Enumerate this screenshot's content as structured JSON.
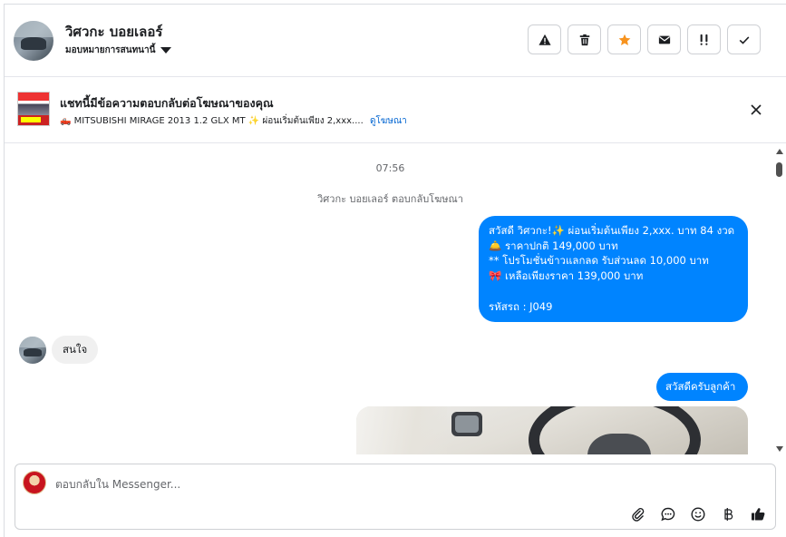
{
  "header": {
    "name": "วิศวกะ บอยเลอร์",
    "assign_label": "มอบหมายการสนทนานี้",
    "actions": [
      {
        "icon": "warning-icon"
      },
      {
        "icon": "trash-icon"
      },
      {
        "icon": "star-icon",
        "color": "#f7931e"
      },
      {
        "icon": "mail-icon"
      },
      {
        "icon": "priority-icon"
      },
      {
        "icon": "check-icon"
      }
    ]
  },
  "ad": {
    "title": "แชทนี้มีข้อความตอบกลับต่อโฆษณาของคุณ",
    "line": "🛻 MITSUBISHI MIRAGE 2013 1.2 GLX MT ✨ ผ่อนเริ่มต้นเพียง 2,xxx....",
    "link": "ดูโฆษณา"
  },
  "chat": {
    "time": "07:56",
    "system_text": "วิศวกะ บอยเลอร์ ตอบกลับโฆษณา",
    "outgoing_1": [
      "สวัสดี วิศวกะ!✨  ผ่อนเริ่มต้นเพียง 2,xxx. บาท 84 งวด",
      "🛎️ ราคาปกติ 149,000 บาท",
      "** โปรโมชั่นข้าวแลกลด รับส่วนลด 10,000 บาท",
      "🎀  เหลือเพียงราคา 139,000 บาท",
      "",
      " รหัสรถ : J049"
    ],
    "incoming_1": "สนใจ",
    "outgoing_2": "สวัสดีครับลูกค้า"
  },
  "composer": {
    "placeholder": "ตอบกลับใน Messenger...",
    "tools": [
      "attach-icon",
      "saved-reply-icon",
      "emoji-icon",
      "baht-icon",
      "like-icon"
    ]
  },
  "colors": {
    "accent": "#0084ff",
    "link": "#0064d1"
  }
}
